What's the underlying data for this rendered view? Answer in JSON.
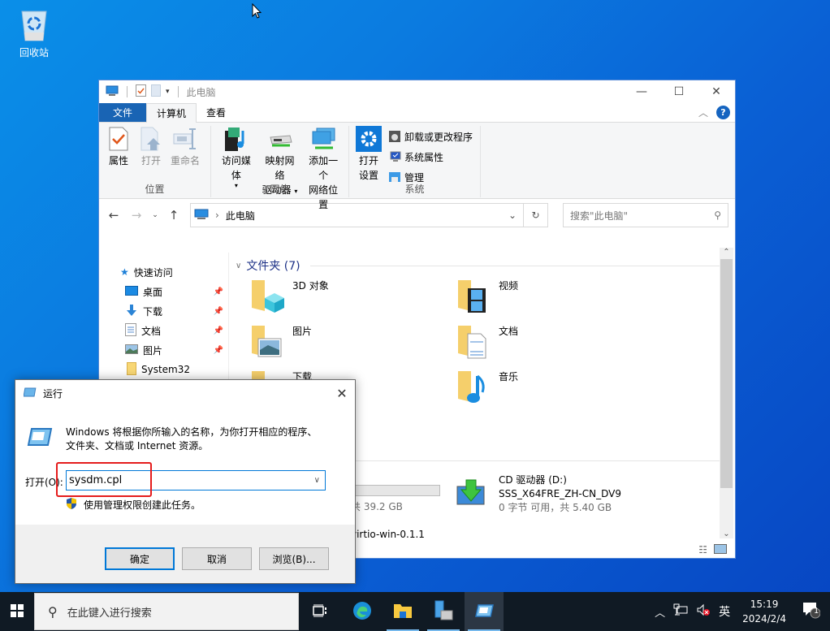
{
  "desktop": {
    "recycle_bin_label": "回收站"
  },
  "explorer": {
    "title": "此电脑",
    "tabs": [
      {
        "label": "文件"
      },
      {
        "label": "计算机"
      },
      {
        "label": "查看"
      }
    ],
    "ribbon": {
      "groups": [
        {
          "label": "位置",
          "buttons": [
            {
              "label": "属性",
              "icon": "properties-icon"
            },
            {
              "label": "打开",
              "icon": "open-icon"
            },
            {
              "label": "重命名",
              "icon": "rename-icon"
            }
          ]
        },
        {
          "label": "网络",
          "buttons": [
            {
              "label": "访问媒体",
              "icon": "media-icon"
            },
            {
              "label_line1": "映射网络",
              "label_line2": "驱动器",
              "icon": "map-drive-icon"
            },
            {
              "label_line1": "添加一个",
              "label_line2": "网络位置",
              "icon": "network-location-icon"
            }
          ]
        },
        {
          "label": "系统",
          "open_settings_line1": "打开",
          "open_settings_line2": "设置",
          "small_buttons": [
            {
              "label": "卸载或更改程序"
            },
            {
              "label": "系统属性"
            },
            {
              "label": "管理"
            }
          ]
        }
      ]
    },
    "address": {
      "path": "此电脑",
      "search_placeholder": "搜索\"此电脑\""
    },
    "nav_pane": [
      {
        "label": "快速访问",
        "icon": "star-icon",
        "pinned": false
      },
      {
        "label": "桌面",
        "icon": "desktop-icon",
        "pinned": true
      },
      {
        "label": "下载",
        "icon": "download-icon",
        "pinned": true
      },
      {
        "label": "文档",
        "icon": "document-icon",
        "pinned": true
      },
      {
        "label": "图片",
        "icon": "picture-icon",
        "pinned": true
      },
      {
        "label": "System32",
        "icon": "folder-icon",
        "pinned": false
      }
    ],
    "section_title": "文件夹 (7)",
    "folders": [
      {
        "name": "3D 对象"
      },
      {
        "name": "视频"
      },
      {
        "name": "图片"
      },
      {
        "name": "文档"
      },
      {
        "name": "下载"
      },
      {
        "name": "音乐"
      }
    ],
    "drives": [
      {
        "size_text": "共 39.2 GB",
        "usage": 0
      },
      {
        "name": "CD 驱动器 (D:)",
        "label": "SSS_X64FRE_ZH-CN_DV9",
        "size_text": "0 字节 可用，共 5.40 GB"
      },
      {
        "name": "virtio-win-0.1.1"
      }
    ]
  },
  "run_dialog": {
    "title": "运行",
    "description_line1": "Windows 将根据你所输入的名称，为你打开相应的程序、",
    "description_line2": "文件夹、文档或 Internet 资源。",
    "open_label": "打开(O):",
    "input_value": "sysdm.cpl",
    "admin_note": "使用管理权限创建此任务。",
    "ok_label": "确定",
    "cancel_label": "取消",
    "browse_label": "浏览(B)..."
  },
  "taskbar": {
    "search_placeholder": "在此键入进行搜索",
    "ime": "英",
    "time": "15:19",
    "date": "2024/2/4",
    "notification_count": "1"
  }
}
